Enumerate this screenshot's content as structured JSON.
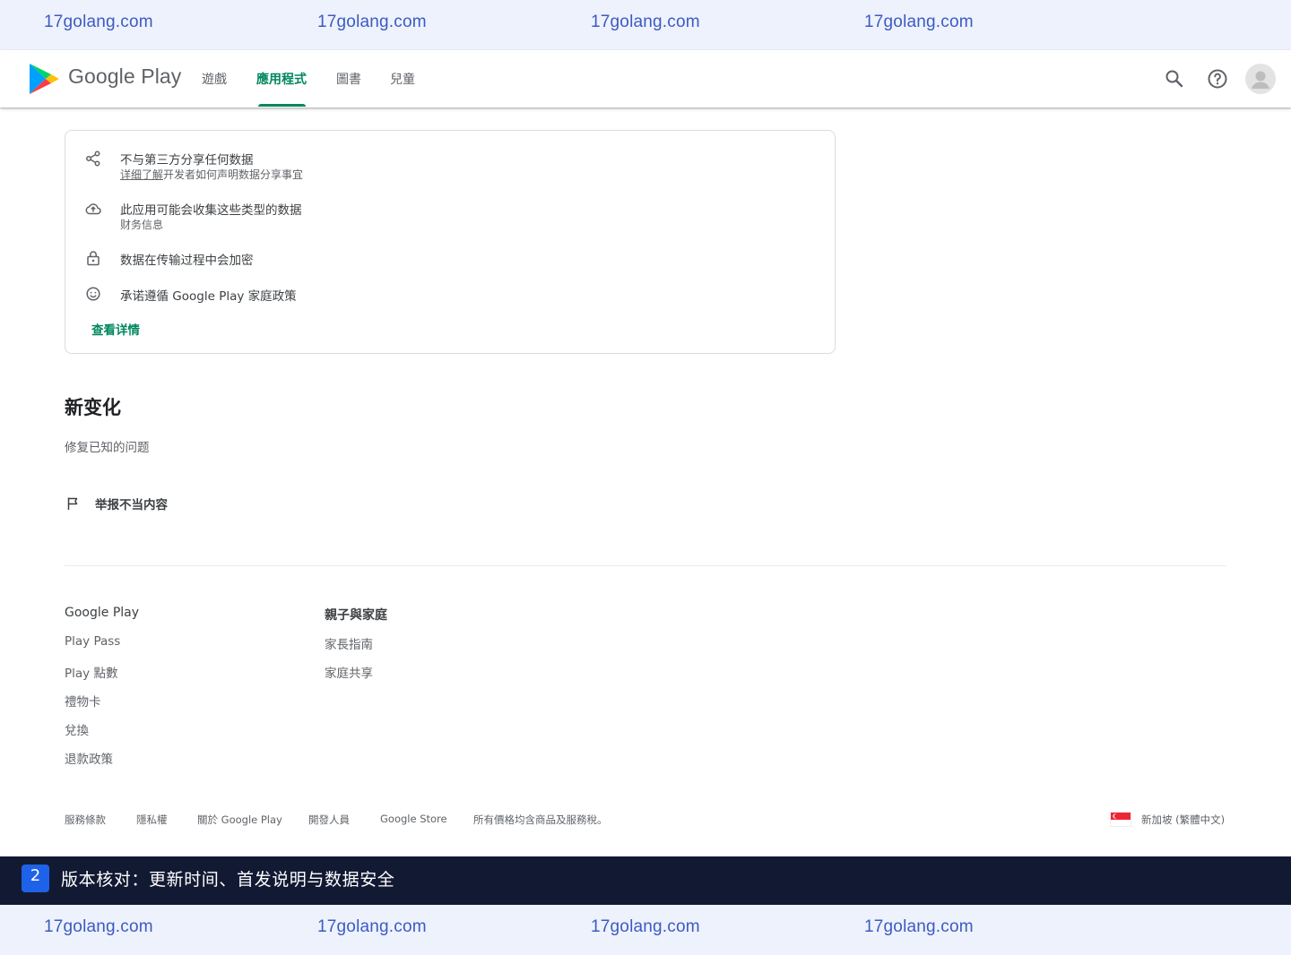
{
  "watermark": {
    "text": "17golang.com",
    "color": "#3d5ac2",
    "background": "#edf2fd"
  },
  "header": {
    "brand": "Google Play",
    "nav": [
      {
        "label": "遊戲",
        "active": false
      },
      {
        "label": "應用程式",
        "active": true
      },
      {
        "label": "圖書",
        "active": false
      },
      {
        "label": "兒童",
        "active": false
      }
    ],
    "icons": [
      "search-icon",
      "help-icon",
      "account-avatar"
    ],
    "accent": "#01875f"
  },
  "data_safety": {
    "rows": [
      {
        "icon": "share-icon",
        "title": "不与第三方分享任何数据",
        "sub_link": "详细了解",
        "sub": "开发者如何声明数据分享事宜"
      },
      {
        "icon": "cloud-upload-icon",
        "title": "此应用可能会收集这些类型的数据",
        "sub": "财务信息"
      },
      {
        "icon": "lock-icon",
        "title": "数据在传输过程中会加密"
      },
      {
        "icon": "family-face-icon",
        "title": "承诺遵循 Google Play 家庭政策"
      }
    ],
    "see_details": "查看详情"
  },
  "whats_new": {
    "title": "新变化",
    "body": "修复已知的问题"
  },
  "report": {
    "label": "举报不当内容",
    "icon": "flag-icon"
  },
  "footer": {
    "col1": {
      "head": "Google Play",
      "links": [
        "Play Pass",
        "Play 點數",
        "禮物卡",
        "兌換",
        "退款政策"
      ]
    },
    "col2": {
      "head": "親子與家庭",
      "links": [
        "家長指南",
        "家庭共享"
      ]
    },
    "legal": [
      "服務條款",
      "隱私權",
      "關於 Google Play",
      "開發人員",
      "Google Store",
      "所有價格均含商品及服務稅。"
    ],
    "locale": "新加坡 (繁體中文)"
  },
  "caption": {
    "badge": "2",
    "text": "版本核对：更新时间、首发说明与数据安全",
    "background": "#121a33",
    "badge_color": "#1f62ea"
  }
}
